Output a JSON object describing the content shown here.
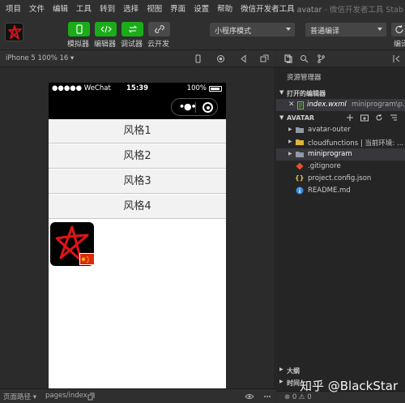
{
  "menubar": {
    "items": [
      "项目",
      "文件",
      "编辑",
      "工具",
      "转到",
      "选择",
      "视图",
      "界面",
      "设置",
      "帮助",
      "微信开发者工具"
    ],
    "window_title": "avatar",
    "window_subtitle": "- 微信开发者工具 Stab"
  },
  "toolbar": {
    "simulator_label": "模拟器",
    "editor_label": "编辑器",
    "debugger_label": "调试器",
    "cloud_label": "云开发",
    "mode_select": "小程序模式",
    "compile_select": "普通编译",
    "compile_label": "编译"
  },
  "simbar": {
    "device": "iPhone 5 100% 16 ▾"
  },
  "phone": {
    "carrier": "●●●●● WeChat",
    "time": "15:39",
    "battery": "100%",
    "capsule_dots": "•●•",
    "styles": [
      "风格1",
      "风格2",
      "风格3",
      "风格4"
    ]
  },
  "statusbar_bottom": {
    "path_label": "页面路径 ▾",
    "path_value": "pages/index"
  },
  "explorer": {
    "title": "资源管理器",
    "open_editors_header": "打开的编辑器",
    "open_file": "index.wxml",
    "open_file_path": "miniprogram\\p...",
    "project_header": "AVATAR",
    "tree": [
      {
        "name": "avatar-outer",
        "type": "folder",
        "chevron": "▶"
      },
      {
        "name": "cloudfunctions | 当前环境: ...",
        "type": "folder-yellow",
        "chevron": "▶"
      },
      {
        "name": "miniprogram",
        "type": "folder",
        "chevron": "▶"
      },
      {
        "name": ".gitignore",
        "type": "git",
        "chevron": ""
      },
      {
        "name": "project.config.json",
        "type": "json",
        "chevron": ""
      },
      {
        "name": "README.md",
        "type": "info",
        "chevron": ""
      }
    ],
    "outline_header": "大纲",
    "timeline_header": "时间",
    "status_errors": "⊗ 0 ⚠ 0"
  },
  "watermark": "知乎 @BlackStar",
  "colors": {
    "accent_green": "#1aad19",
    "panel_bg": "#252526",
    "toolbar_bg": "#2f2f2f"
  }
}
